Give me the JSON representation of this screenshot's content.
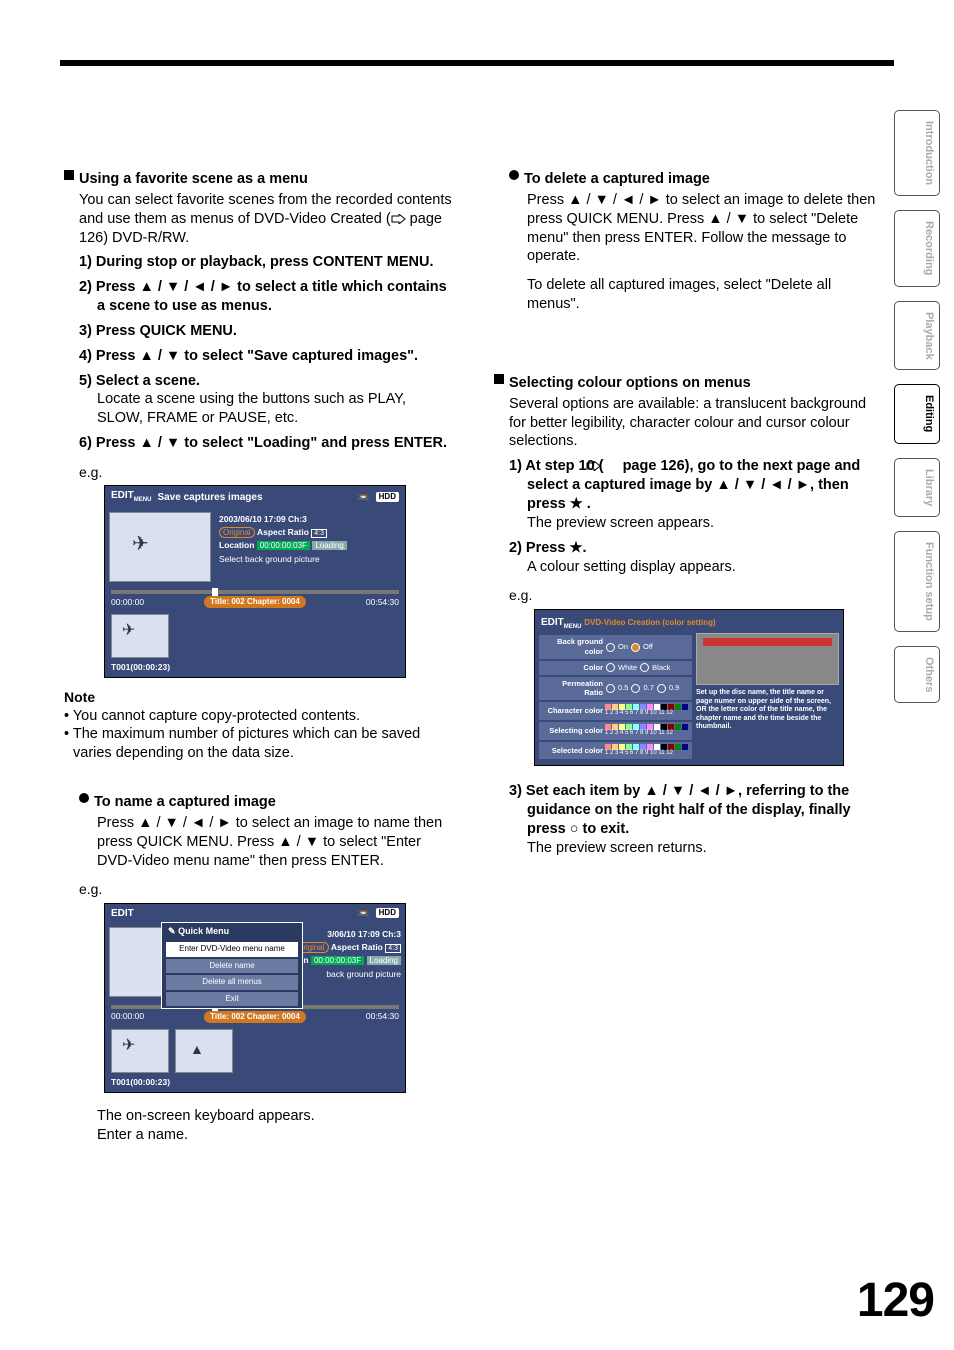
{
  "page_number": "129",
  "side_tabs": [
    "Introduction",
    "Recording",
    "Playback",
    "Editing",
    "Library",
    "Function setup",
    "Others"
  ],
  "active_tab_index": 3,
  "left": {
    "h1": "Using a favorite scene as a menu",
    "p1a": "You can select favorite scenes from the recorded contents and use them as menus of DVD-Video Created (",
    "p1b": " page 126) DVD-R/RW.",
    "s1": "1) During stop or playback, press CONTENT MENU.",
    "s2": "2) Press ▲ / ▼ / ◄ / ► to select a title which contains a scene to use as menus.",
    "s3": "3) Press QUICK MENU.",
    "s4": "4) Press ▲ / ▼ to select \"Save captured images\".",
    "s5": "5) Select a scene.",
    "s5b": "Locate a scene using the buttons such as PLAY, SLOW, FRAME or PAUSE, etc.",
    "s6": "6) Press ▲ / ▼ to select \"Loading\" and press ENTER.",
    "eg": "e.g.",
    "osd1": {
      "title_l": "EDIT",
      "title_sub": "MENU",
      "title_r": "Save captures images",
      "hdd": "HDD",
      "date": "2003/06/10  17:09  Ch:3",
      "orig": "Original",
      "aspect": "Aspect Ratio",
      "ratio": "4:3",
      "loc": "Location",
      "time": "00:00:00:03F",
      "load": "Loading",
      "sel": "Select back ground picture",
      "t_left": "00:00:00",
      "t_mid": "Title: 002  Chapter: 0004",
      "t_right": "00:54:30",
      "cap": "T001(00:00:23)"
    },
    "note_h": "Note",
    "note1": "• You cannot capture copy-protected contents.",
    "note2": "• The maximum number of pictures which can be saved varies depending on the data size.",
    "h2": "To name a captured image",
    "h2b": "Press ▲ / ▼ / ◄ / ► to select an image to name then press QUICK MENU. Press ▲ / ▼ to select \"Enter DVD-Video menu name\" then press ENTER.",
    "qm": {
      "h": "Quick Menu",
      "i1": "Enter DVD-Video menu name",
      "i2": "Delete name",
      "i3": "Delete all menus",
      "i4": "Exit"
    },
    "foot1": "The on-screen keyboard appears.",
    "foot2": "Enter a name."
  },
  "right": {
    "h1": "To delete a captured image",
    "p1": "Press ▲ / ▼ / ◄ / ► to select an image to delete then press QUICK MENU. Press ▲ / ▼ to select \"Delete menu\" then press ENTER. Follow the message to operate.",
    "p2": "To delete all captured images, select \"Delete all menus\".",
    "h2": "Selecting colour options on menus",
    "p3": "Several options are available: a translucent background for better legibility, character colour and cursor colour selections.",
    "s1a": "1) At step 10 (",
    "s1b": " page 126), go to the next page and select a captured image by ▲ / ▼ / ◄ / ►, then press ",
    "s1c": " .",
    "s1r": "The preview screen appears.",
    "s2a": "2) Press ",
    "s2b": ".",
    "s2r": "A colour setting display appears.",
    "eg": "e.g.",
    "osd2": {
      "title": "EDIT",
      "sub": "MENU",
      "titler": "DVD-Video Creation (color setting)",
      "r1": "Back ground color",
      "r1a": "On",
      "r1b": "Off",
      "r2": "Color",
      "r2a": "White",
      "r2b": "Black",
      "r3": "Permeation Ratio",
      "r3a": "0.5",
      "r3b": "0.7",
      "r3c": "0.9",
      "r4": "Character color",
      "nums": "1 2 3 4 5 6 7 8 9 10 11 12",
      "r5": "Selecting color",
      "r6": "Selected color",
      "help": "Set up the disc name, the title name or page numer on upper side of the screen, OR the letter color of the title name, the chapter name and the time beside the thumbnail."
    },
    "s3": "3) Set each item by ▲ / ▼ / ◄ / ►, referring to the guidance on the right half of the display, finally press ",
    "s3b": " to exit.",
    "s3r": "The preview screen returns."
  }
}
